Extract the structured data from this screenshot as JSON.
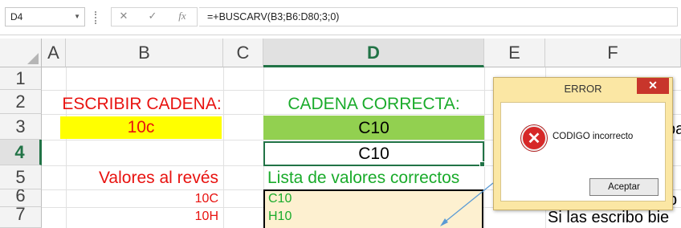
{
  "formula_bar": {
    "name_box": "D4",
    "formula": "=+BUSCARV(B3;B6:D80;3;0)",
    "cancel_glyph": "✕",
    "enter_glyph": "✓",
    "fx_glyph": "fx"
  },
  "columns": [
    "A",
    "B",
    "C",
    "D",
    "E",
    "F"
  ],
  "rows": [
    "1",
    "2",
    "3",
    "4",
    "5",
    "6",
    "7"
  ],
  "selected_cell": {
    "column": "D",
    "row": "4"
  },
  "cells": {
    "b2": "ESCRIBIR CADENA:",
    "d2": "CADENA CORRECTA:",
    "b3": "10c",
    "d3": "C10",
    "d4": "C10",
    "b5": "Valores al revés",
    "d5": "Lista de valores correctos",
    "b6": "10C",
    "b7": "10H",
    "d6": "C10",
    "d7": "H10",
    "f3_partial": "pa",
    "f5_partial": "",
    "f7_partial": "Si las escribo bie"
  },
  "colors": {
    "red_text": "#e8120f",
    "green_text": "#1aab2b",
    "yellow_fill": "#ffff00",
    "green_fill": "#92d050",
    "list_fill": "#fdf0d0",
    "selection": "#217346"
  },
  "dialog": {
    "title": "ERROR",
    "close_glyph": "✕",
    "icon": "error-icon",
    "message": "CODIGO incorrecto",
    "button": "Aceptar"
  }
}
